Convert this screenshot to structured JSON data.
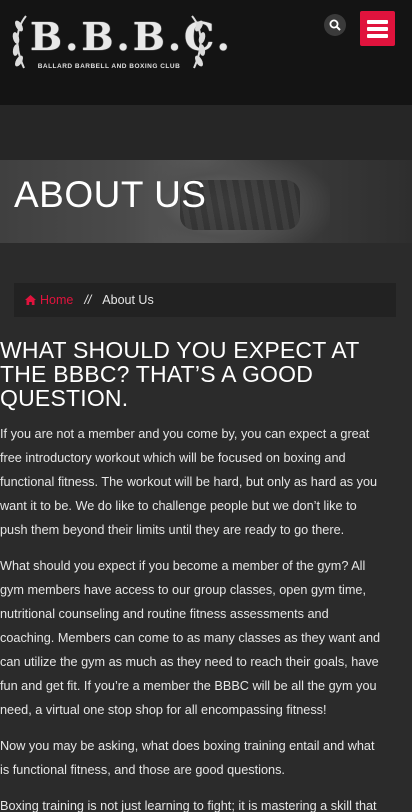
{
  "header": {
    "logo_text": "B.B.B.C.",
    "logo_subtitle": "BALLARD BARBELL AND BOXING CLUB",
    "accent_color": "#e0133d"
  },
  "icons": {
    "search": "search-icon",
    "menu": "hamburger-menu-icon",
    "home": "home-icon"
  },
  "hero": {
    "title": "ABOUT US"
  },
  "breadcrumb": {
    "home": "Home",
    "separator": "//",
    "current": "About Us"
  },
  "content": {
    "heading_lines": [
      "WHAT SHOULD YOU EXPECT AT",
      "THE BBBC?  THAT’S A GOOD",
      "QUESTION."
    ],
    "p1_lines": [
      "If you are not a member and you come by, you can expect a great",
      "free introductory workout which will be focused on boxing and",
      "functional fitness. The workout will be hard, but only as hard as you",
      "want it to be. We do like to challenge people but we don’t like to",
      "push them beyond their limits until they are ready to go there."
    ],
    "p2_lines": [
      "What should you expect if you become a member of the gym? All",
      "gym members have access to our group classes, open gym time,",
      "nutritional counseling and routine fitness assessments and",
      "coaching. Members can come to as many classes as they want and",
      "can utilize the gym as much as they need to reach their goals, have",
      "fun and get fit. If you’re a member the BBBC will be all the gym you",
      "need, a virtual one stop shop for all encompassing fitness!"
    ],
    "p3_lines": [
      "Now you may be asking, what does boxing training entail and what",
      "is functional fitness, and those are good questions."
    ],
    "p4_lines": [
      "Boxing training is not just learning to fight; it is mastering a skill that"
    ]
  }
}
